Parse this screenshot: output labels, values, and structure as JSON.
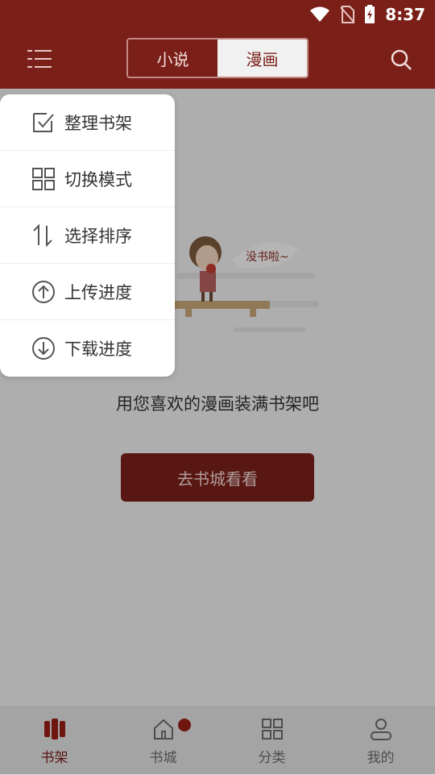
{
  "status_bar": {
    "time": "8:37",
    "icons": [
      "wifi-icon",
      "no-sim-icon",
      "battery-charging-icon"
    ]
  },
  "header": {
    "tabs": [
      {
        "label": "小说",
        "active": false
      },
      {
        "label": "漫画",
        "active": true
      }
    ],
    "menu_icon": "menu-icon",
    "search_icon": "search-icon"
  },
  "empty_state": {
    "illustration_text": "没书啦~",
    "message": "用您喜欢的漫画装满书架吧",
    "button_label": "去书城看看"
  },
  "popup_menu": {
    "items": [
      {
        "label": "整理书架",
        "icon": "edit-check-icon"
      },
      {
        "label": "切换模式",
        "icon": "grid-icon"
      },
      {
        "label": "选择排序",
        "icon": "sort-icon"
      },
      {
        "label": "上传进度",
        "icon": "upload-icon"
      },
      {
        "label": "下载进度",
        "icon": "download-icon"
      }
    ]
  },
  "bottom_nav": {
    "items": [
      {
        "label": "书架",
        "icon": "bookshelf-icon",
        "active": true
      },
      {
        "label": "书城",
        "icon": "home-icon",
        "active": false,
        "badge": true
      },
      {
        "label": "分类",
        "icon": "category-icon",
        "active": false
      },
      {
        "label": "我的",
        "icon": "profile-icon",
        "active": false
      }
    ]
  },
  "colors": {
    "primary": "#7b2019",
    "background": "#f1f1f1",
    "overlay": "rgba(0,0,0,0.28)"
  }
}
